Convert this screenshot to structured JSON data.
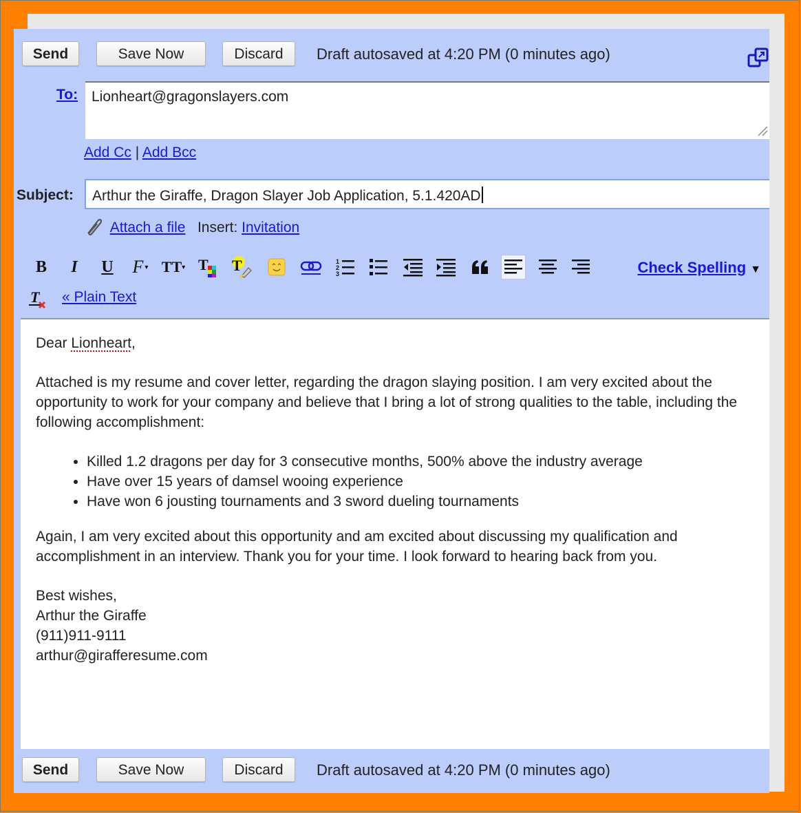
{
  "toolbar_top": {
    "send_label": "Send",
    "save_label": "Save Now",
    "discard_label": "Discard",
    "status": "Draft autosaved at 4:20 PM (0 minutes ago)",
    "popout_icon": "popout-window-icon"
  },
  "to": {
    "label": "To:",
    "value": "Lionheart@gragonslayers.com"
  },
  "cc_links": {
    "add_cc": "Add Cc",
    "separator": "|",
    "add_bcc": "Add Bcc"
  },
  "subject": {
    "label": "Subject:",
    "value": "Arthur the Giraffe, Dragon Slayer Job Application, 5.1.420AD"
  },
  "attach": {
    "attach_label": "Attach a file",
    "insert_label": "Insert:",
    "invitation_label": "Invitation"
  },
  "format_toolbar": {
    "buttons": [
      {
        "name": "bold",
        "glyph": "B"
      },
      {
        "name": "italic",
        "glyph": "I"
      },
      {
        "name": "underline",
        "glyph": "U"
      },
      {
        "name": "font",
        "glyph": "F"
      },
      {
        "name": "font-size",
        "glyph": "TT"
      },
      {
        "name": "text-color",
        "glyph": "T"
      },
      {
        "name": "highlight-color",
        "glyph": "T"
      },
      {
        "name": "emoticon",
        "glyph": ""
      },
      {
        "name": "link",
        "glyph": ""
      },
      {
        "name": "numbered-list",
        "glyph": ""
      },
      {
        "name": "bulleted-list",
        "glyph": ""
      },
      {
        "name": "indent-less",
        "glyph": ""
      },
      {
        "name": "indent-more",
        "glyph": ""
      },
      {
        "name": "quote",
        "glyph": "❝"
      },
      {
        "name": "align-left",
        "glyph": ""
      },
      {
        "name": "align-center",
        "glyph": ""
      },
      {
        "name": "align-right",
        "glyph": ""
      }
    ],
    "active": "align-left",
    "check_spelling_label": "Check Spelling",
    "check_spelling_arrow": "▼",
    "plain_text_label": "« Plain Text"
  },
  "body": {
    "greeting_prefix": "Dear ",
    "greeting_name": "Lionheart",
    "greeting_suffix": ",",
    "paragraph1": "Attached is my resume and cover letter, regarding the dragon slaying position.  I am very excited about the opportunity to work for your company and believe that I bring a lot of strong qualities to the table, including the following accomplishment:",
    "bullets": [
      "Killed 1.2 dragons per day for 3 consecutive months, 500% above the industry average",
      "Have over 15 years of damsel wooing experience",
      "Have won 6 jousting tournaments and 3 sword dueling tournaments"
    ],
    "paragraph2": "Again, I am very excited about this opportunity and am excited about discussing my qualification and accomplishment in an interview.  Thank you for your time.  I look forward to hearing back from you.",
    "signature": [
      "Best wishes,",
      "Arthur the Giraffe",
      "(911)911-9111",
      "arthur@girafferesume.com"
    ]
  },
  "toolbar_bottom": {
    "send_label": "Send",
    "save_label": "Save Now",
    "discard_label": "Discard",
    "status": "Draft autosaved at 4:20 PM (0 minutes ago)"
  },
  "colors": {
    "frame": "#ff8000",
    "compose_bg": "#bccdfb",
    "link": "#1a1acc"
  }
}
